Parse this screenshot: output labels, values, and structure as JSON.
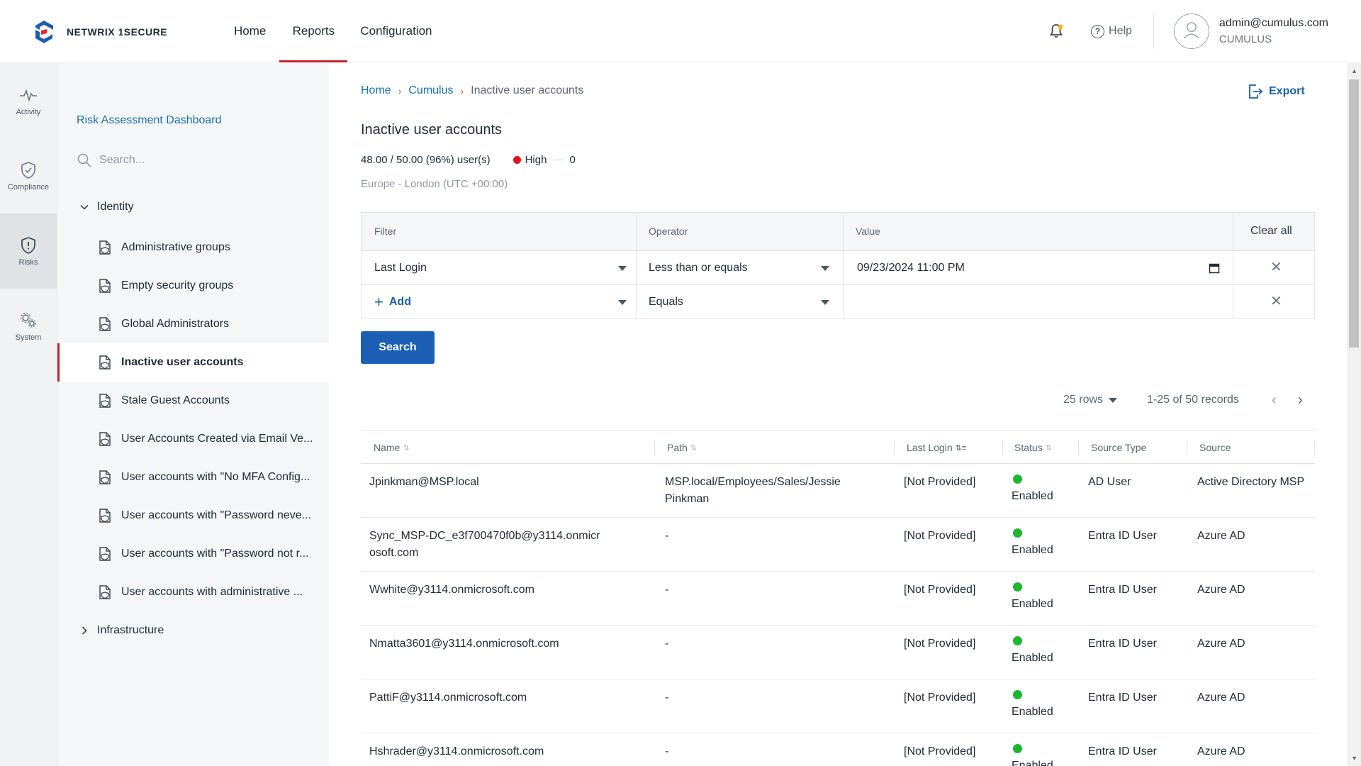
{
  "brand": {
    "name": "NETWRIX 1SECURE",
    "accent": "#c8202f",
    "logo_blue": "#1d5fad"
  },
  "topnav": {
    "items": [
      {
        "label": "Home"
      },
      {
        "label": "Reports"
      },
      {
        "label": "Configuration"
      }
    ],
    "active": "Reports"
  },
  "header": {
    "help": "Help",
    "user_email": "admin@cumulus.com",
    "user_org": "CUMULUS"
  },
  "rail": {
    "items": [
      {
        "label": "Activity"
      },
      {
        "label": "Compliance"
      },
      {
        "label": "Risks"
      },
      {
        "label": "System"
      }
    ],
    "active": "Risks"
  },
  "sidebar": {
    "dashboard_link": "Risk Assessment Dashboard",
    "search_placeholder": "Search...",
    "groups": [
      {
        "label": "Identity",
        "expanded": true
      },
      {
        "label": "Infrastructure",
        "expanded": false
      }
    ],
    "items": [
      {
        "label": "Administrative groups"
      },
      {
        "label": "Empty security groups"
      },
      {
        "label": "Global Administrators"
      },
      {
        "label": "Inactive user accounts"
      },
      {
        "label": "Stale Guest Accounts"
      },
      {
        "label": "User Accounts Created via Email Ve..."
      },
      {
        "label": "User accounts with \"No MFA Config..."
      },
      {
        "label": "User accounts with \"Password neve..."
      },
      {
        "label": "User accounts with \"Password not r..."
      },
      {
        "label": "User accounts with administrative ..."
      }
    ],
    "active_item": "Inactive user accounts"
  },
  "breadcrumb": {
    "home": "Home",
    "org": "Cumulus",
    "current": "Inactive user accounts"
  },
  "export_label": "Export",
  "page": {
    "title": "Inactive user accounts",
    "ratio": "48.00 / 50.00 (96%) user(s)",
    "severity": "High",
    "severity_count": "0",
    "timezone": "Europe - London (UTC +00:00)"
  },
  "filter": {
    "headers": {
      "filter": "Filter",
      "operator": "Operator",
      "value": "Value",
      "clear_all": "Clear all"
    },
    "rows": [
      {
        "filter": "Last Login",
        "operator": "Less than or equals",
        "value": "09/23/2024 11:00 PM"
      },
      {
        "filter": "Add",
        "operator": "Equals",
        "value": ""
      }
    ]
  },
  "search_button": "Search",
  "pagination": {
    "rows": "25 rows",
    "records": "1-25 of 50 records"
  },
  "table": {
    "columns": [
      "Name",
      "Path",
      "Last Login",
      "Status",
      "Source Type",
      "Source"
    ],
    "rows": [
      {
        "name": "Jpinkman@MSP.local",
        "path": "MSP.local/Employees/Sales/Jessie Pinkman",
        "last_login": "[Not Provided]",
        "status": "Enabled",
        "source_type": "AD User",
        "source": "Active Directory MSP"
      },
      {
        "name": "Sync_MSP-DC_e3f700470f0b@y3114.onmicrosoft.com",
        "path": "-",
        "last_login": "[Not Provided]",
        "status": "Enabled",
        "source_type": "Entra ID User",
        "source": "Azure AD"
      },
      {
        "name": "Wwhite@y3114.onmicrosoft.com",
        "path": "-",
        "last_login": "[Not Provided]",
        "status": "Enabled",
        "source_type": "Entra ID User",
        "source": "Azure AD"
      },
      {
        "name": "Nmatta3601@y3114.onmicrosoft.com",
        "path": "-",
        "last_login": "[Not Provided]",
        "status": "Enabled",
        "source_type": "Entra ID User",
        "source": "Azure AD"
      },
      {
        "name": "PattiF@y3114.onmicrosoft.com",
        "path": "-",
        "last_login": "[Not Provided]",
        "status": "Enabled",
        "source_type": "Entra ID User",
        "source": "Azure AD"
      },
      {
        "name": "Hshrader@y3114.onmicrosoft.com",
        "path": "-",
        "last_login": "[Not Provided]",
        "status": "Enabled",
        "source_type": "Entra ID User",
        "source": "Azure AD"
      }
    ]
  }
}
